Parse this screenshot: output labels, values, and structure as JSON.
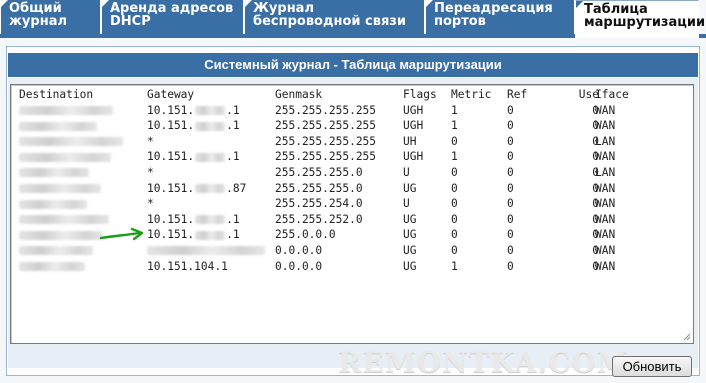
{
  "tabs": [
    {
      "label": "Общий журнал",
      "active": false
    },
    {
      "label": "Аренда адресов DHCP",
      "active": false
    },
    {
      "label": "Журнал беспроводной связи",
      "active": false
    },
    {
      "label": "Переадресация портов",
      "active": false
    },
    {
      "label": "Таблица маршрутизации",
      "active": true
    }
  ],
  "panel": {
    "title": "Системный журнал - Таблица маршрутизации"
  },
  "routing_table": {
    "columns": [
      "Destination",
      "Gateway",
      "Genmask",
      "Flags",
      "Metric",
      "Ref",
      "Use",
      "Iface"
    ],
    "rows": [
      {
        "gw_prefix": "10.151.",
        "gw_suffix": ".1",
        "mask": "255.255.255.255",
        "flags": "UGH",
        "metric": "1",
        "ref": "0",
        "use": "0",
        "iface": "WAN"
      },
      {
        "gw_prefix": "10.151.",
        "gw_suffix": ".1",
        "mask": "255.255.255.255",
        "flags": "UGH",
        "metric": "1",
        "ref": "0",
        "use": "0",
        "iface": "WAN"
      },
      {
        "gw_prefix": "*",
        "gw_suffix": "",
        "mask": "255.255.255.255",
        "flags": "UH",
        "metric": "0",
        "ref": "0",
        "use": "0",
        "iface": "LAN"
      },
      {
        "gw_prefix": "10.151.",
        "gw_suffix": ".1",
        "mask": "255.255.255.255",
        "flags": "UGH",
        "metric": "1",
        "ref": "0",
        "use": "0",
        "iface": "WAN"
      },
      {
        "gw_prefix": "*",
        "gw_suffix": "",
        "mask": "255.255.255.0",
        "flags": "U",
        "metric": "0",
        "ref": "0",
        "use": "0",
        "iface": "LAN"
      },
      {
        "gw_prefix": "10.151.",
        "gw_suffix": ".87",
        "mask": "255.255.255.0",
        "flags": "UG",
        "metric": "0",
        "ref": "0",
        "use": "0",
        "iface": "WAN"
      },
      {
        "gw_prefix": "*",
        "gw_suffix": "",
        "mask": "255.255.254.0",
        "flags": "U",
        "metric": "0",
        "ref": "0",
        "use": "0",
        "iface": "WAN"
      },
      {
        "gw_prefix": "10.151.",
        "gw_suffix": ".1",
        "mask": "255.255.252.0",
        "flags": "UG",
        "metric": "0",
        "ref": "0",
        "use": "0",
        "iface": "WAN"
      },
      {
        "gw_prefix": "10.151.",
        "gw_suffix": ".1",
        "mask": "255.0.0.0",
        "flags": "UG",
        "metric": "0",
        "ref": "0",
        "use": "0",
        "iface": "WAN"
      },
      {
        "gw_prefix": "",
        "gw_suffix": "",
        "mask": "0.0.0.0",
        "flags": "UG",
        "metric": "0",
        "ref": "0",
        "use": "0",
        "iface": "WAN"
      },
      {
        "gw_prefix": "10.151.104.1",
        "gw_suffix": "",
        "mask": "0.0.0.0",
        "flags": "UG",
        "metric": "1",
        "ref": "0",
        "use": "0",
        "iface": "WAN"
      }
    ]
  },
  "watermark": "REMONTKA.COM",
  "buttons": {
    "refresh": "Обновить"
  },
  "colors": {
    "tab_bg": "#3a6fa5",
    "header_bg": "#3a6fa5",
    "arrow": "#1a9e1a"
  },
  "icons": {
    "annotation_arrow": "green-arrow-icon"
  }
}
